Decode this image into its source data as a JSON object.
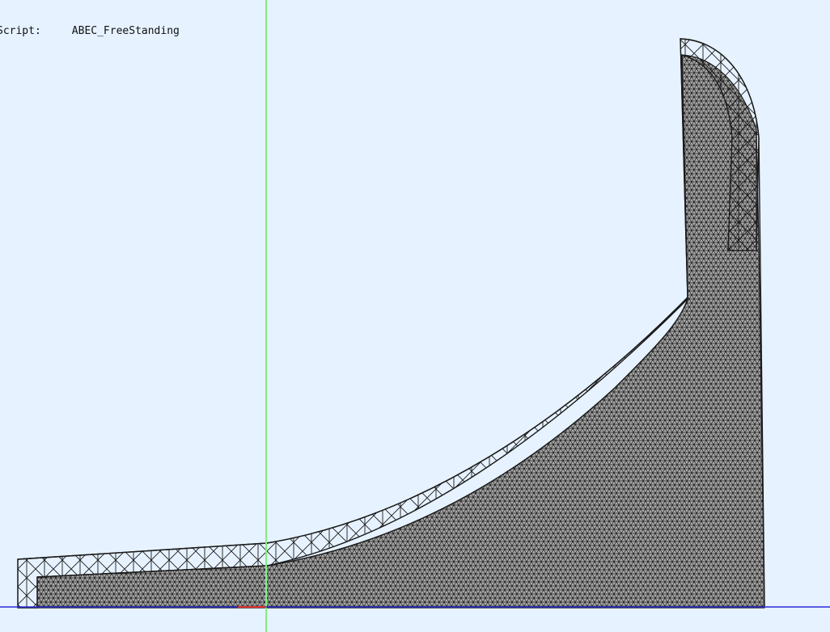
{
  "info": {
    "script_label": "Script:",
    "script_value": "ABEC_FreeStanding"
  },
  "colors": {
    "background": "#e6f2ff",
    "vertical_axis": "#7ef07e",
    "horizontal_axis": "#2b2bd6",
    "origin_marker": "#e03030",
    "mesh_fill": "#a9a9a9",
    "mesh_edge": "#1a1a1a"
  }
}
